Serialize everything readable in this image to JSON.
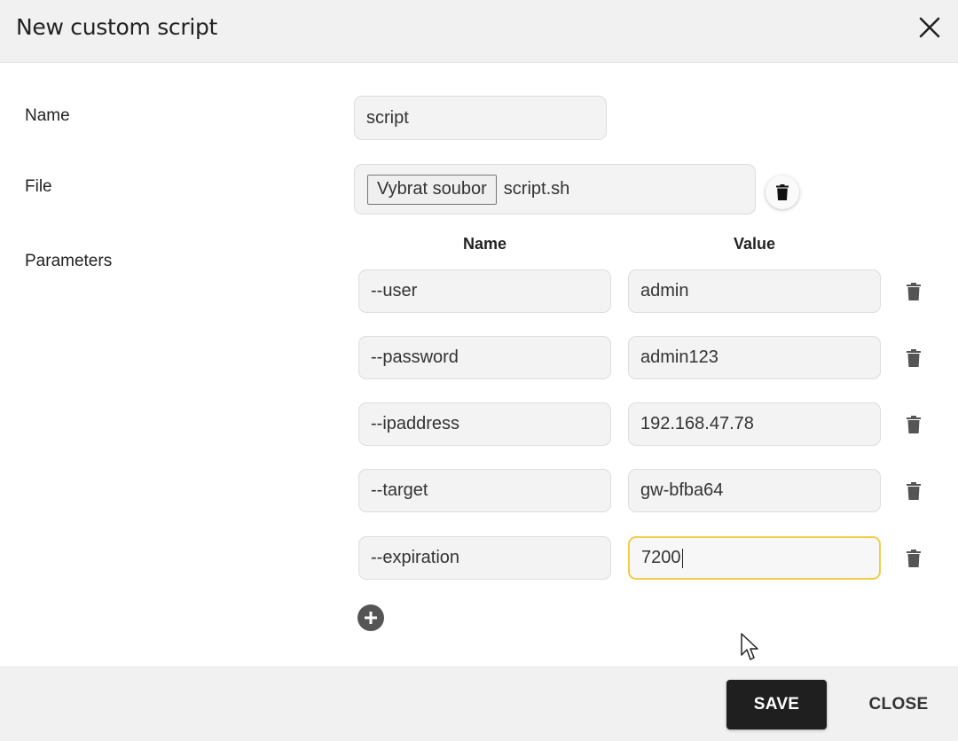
{
  "dialog": {
    "title": "New custom script",
    "close_icon": "close-x-icon"
  },
  "form": {
    "name_label": "Name",
    "name_value": "script",
    "file_label": "File",
    "file_button_label": "Vybrat soubor",
    "file_name": "script.sh",
    "file_delete_icon": "trash-icon",
    "parameters_label": "Parameters",
    "param_col_name": "Name",
    "param_col_value": "Value",
    "parameters": [
      {
        "name": "--user",
        "value": "admin"
      },
      {
        "name": "--password",
        "value": "admin123"
      },
      {
        "name": "--ipaddress",
        "value": "192.168.47.78"
      },
      {
        "name": "--target",
        "value": "gw-bfba64"
      },
      {
        "name": "--expiration",
        "value": "7200",
        "focused": true
      }
    ],
    "add_parameter_icon": "plus-circle-icon"
  },
  "footer": {
    "save_label": "SAVE",
    "close_label": "CLOSE"
  },
  "colors": {
    "focus_border": "#f2cd4a",
    "primary_button": "#1f1f1f",
    "header_bg": "#f1f1f1"
  }
}
